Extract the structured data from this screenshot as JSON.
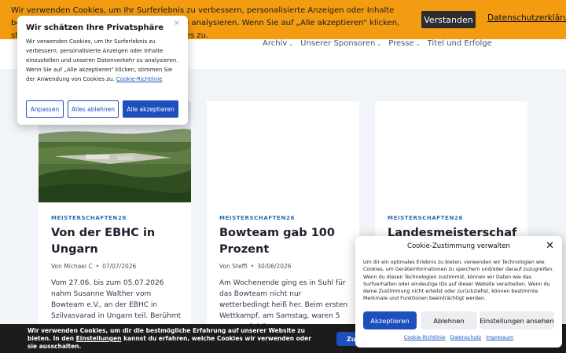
{
  "header": {
    "nav": [
      {
        "label": "Archiv",
        "dropdown": true
      },
      {
        "label": "Unserer Sponsoren",
        "dropdown": true
      },
      {
        "label": "Presse",
        "dropdown": true
      },
      {
        "label": "Titel und Erfolge",
        "dropdown": false
      }
    ]
  },
  "top_cookie_bar": {
    "text": "Wir verwenden Cookies, um Ihr Surferlebnis zu verbessern, personalisierte Anzeigen oder Inhalte bereitzustellen und unseren Datenverkehr zu analysieren. Wenn Sie auf „Alle akzeptieren“ klicken, stimmen Sie unserer Verwendung von Cookies zu.",
    "button": "Verstanden",
    "link": "Datenschutzerklärung",
    "background": "#f39c12"
  },
  "privacy_popup": {
    "title": "Wir schätzen Ihre Privatsphäre",
    "close": "×",
    "text": "Wir verwenden Cookies, um Ihr Surferlebnis zu verbessern, personalisierte Anzeigen oder Inhalte einzustellen und unseren Datenverkehr zu analysieren. Wenn Sie auf „Alle akzeptieren“ klicken, stimmen Sie der Anwendung von Cookies zu.",
    "policy_link": "Cookie-Richtlinie",
    "buttons": {
      "customize": "Anpassen",
      "reject": "Alles ablehnen",
      "accept": "Alle akzeptieren"
    }
  },
  "posts": [
    {
      "category": "MEISTERSCHAFTEN26",
      "title": "Von der EBHC in Ungarn",
      "author": "Von Michael C",
      "date": "07/07/2026",
      "excerpt": "Vom 27.06. bis zum 05.07.2026 nahm Susanne Walther vom Bowteam e.V., an der EBHC in Szilvasvarad in Ungarn teil. Berühmt",
      "has_image": true
    },
    {
      "category": "MEISTERSCHAFTEN26",
      "title": "Bowteam gab 100 Prozent",
      "author": "Von Steffi",
      "date": "30/06/2026",
      "excerpt": "Am Wochenende ging es in Suhl für das Bowteam nicht nur wetterbedingt heiß her. Beim ersten Wettkampf, am Samstag, waren 5 unserer Schützen",
      "has_image": false
    },
    {
      "category": "MEISTERSCHAFTEN26",
      "title": "Landesmeisterschaf",
      "author": "",
      "date": "",
      "excerpt": "",
      "has_image": false
    }
  ],
  "bottom_bar": {
    "text_before": "Wir verwenden Cookies, um dir die bestmögliche Erfahrung auf unserer Website zu bieten. In den ",
    "settings_link": "Einstellungen",
    "text_after": " kannst du erfahren, welche Cookies wir verwenden oder sie ausschalten.",
    "button": "Zu"
  },
  "consent_dialog": {
    "title": "Cookie-Zustimmung verwalten",
    "close": "✕",
    "text": "Um dir ein optimales Erlebnis zu bieten, verwenden wir Technologien wie Cookies, um Geräteinformationen zu speichern und/oder darauf zuzugreifen. Wenn du diesen Technologien zustimmst, können wir Daten wie das Surfverhalten oder eindeutige IDs auf dieser Website verarbeiten. Wenn du deine Zustimmung nicht erteilst oder zurückziehst, können bestimmte Merkmale und Funktionen beeinträchtigt werden.",
    "buttons": {
      "accept": "Akzeptieren",
      "deny": "Ablehnen",
      "settings": "Einstellungen ansehen"
    },
    "links": [
      "Cookie-Richtlinie",
      "Datenschutz",
      "Impressum"
    ],
    "accent": "#1e4fbf"
  }
}
